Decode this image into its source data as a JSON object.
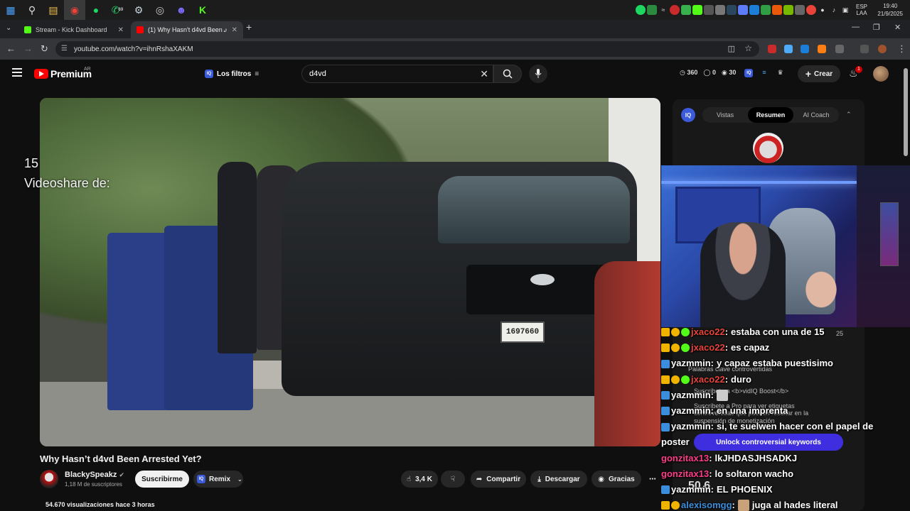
{
  "taskbar": {
    "lang_top": "ESP",
    "lang_bottom": "LAA",
    "time": "19:40",
    "date": "21/9/2025",
    "whatsapp_badge": "69"
  },
  "tabs": [
    {
      "label": "Stream - Kick Dashboard",
      "favicon_color": "#53fc18"
    },
    {
      "label": "(1) Why Hasn't d4vd Been A",
      "favicon_color": "#ff0000"
    }
  ],
  "address": {
    "url": "youtube.com/watch?v=ihnRshaXAKM"
  },
  "youtube": {
    "brand": "Premium",
    "region": "AR",
    "filters_label": "Los filtros",
    "search_value": "d4vd",
    "stats": {
      "views": "360",
      "likes": "0",
      "watch": "30"
    },
    "create_label": "Crear",
    "notif_count": "1"
  },
  "video": {
    "overlay_line1": "15",
    "overlay_line2": "Videoshare de:",
    "plate": "1697660",
    "title": "Why Hasn’t d4vd Been Arrested Yet?",
    "channel": "BlackySpeakz",
    "subscribers": "1,18 M de suscriptores",
    "subscribe_label": "Suscribirme",
    "remix_label": "Remix",
    "likes": "3,4 K",
    "share_label": "Compartir",
    "download_label": "Descargar",
    "thanks_label": "Gracias",
    "views_line": "54.670 visualizaciones hace 3 horas"
  },
  "vidiq": {
    "logo": "IQ",
    "tabs": [
      "Vistas",
      "Resumen",
      "AI Coach"
    ],
    "active_tab": "Resumen",
    "ghost_keywords": "Palabras clave controvertidas",
    "ghost_sub": "Suscríbete a <b>vidIQ Boost</b>",
    "ghost_pro": "Suscríbete a Pro para ver etiquetas",
    "ghost_pro2": "controvertidas que pueden resultar en la",
    "ghost_pro3": "suspensión de monetización",
    "unlock_label": "Unlock controversial keywords",
    "ghost_score": "50.6",
    "ghost_date": "25"
  },
  "chat": [
    {
      "user": "jxaco22",
      "color": "#e8443a",
      "text": "estaba con una de 15",
      "badges": [
        "sub",
        "star",
        "gift"
      ]
    },
    {
      "user": "jxaco22",
      "color": "#e8443a",
      "text": "es capaz",
      "badges": [
        "sub",
        "star",
        "gift"
      ]
    },
    {
      "user": "yazmmin",
      "color": "#ffffff",
      "text": "y capaz estaba puestisimo",
      "badges": [
        "og"
      ]
    },
    {
      "user": "jxaco22",
      "color": "#e8443a",
      "text": "duro",
      "badges": [
        "sub",
        "star",
        "gift"
      ]
    },
    {
      "user": "yazmmin",
      "color": "#ffffff",
      "text": "",
      "badges": [
        "og"
      ]
    },
    {
      "user": "yazmmin",
      "color": "#ffffff",
      "text": "en una imprenta",
      "badges": [
        "og"
      ]
    },
    {
      "user": "yazmmin",
      "color": "#ffffff",
      "text": "si, te suelwen hacer con el papel de poster",
      "badges": [
        "og"
      ]
    },
    {
      "user": "gonzitax13",
      "color": "#ff3b8a",
      "text": "lkJHDASJHSADKJ",
      "badges": []
    },
    {
      "user": "gonzitax13",
      "color": "#ff3b8a",
      "text": "lo soltaron wacho",
      "badges": []
    },
    {
      "user": "yazmmin",
      "color": "#ffffff",
      "text": "EL PHOENIX",
      "badges": [
        "og"
      ]
    },
    {
      "user": "alexisomgg",
      "color": "#3b8edb",
      "text": "juga al hades literal",
      "badges": [
        "sub",
        "star"
      ]
    }
  ]
}
